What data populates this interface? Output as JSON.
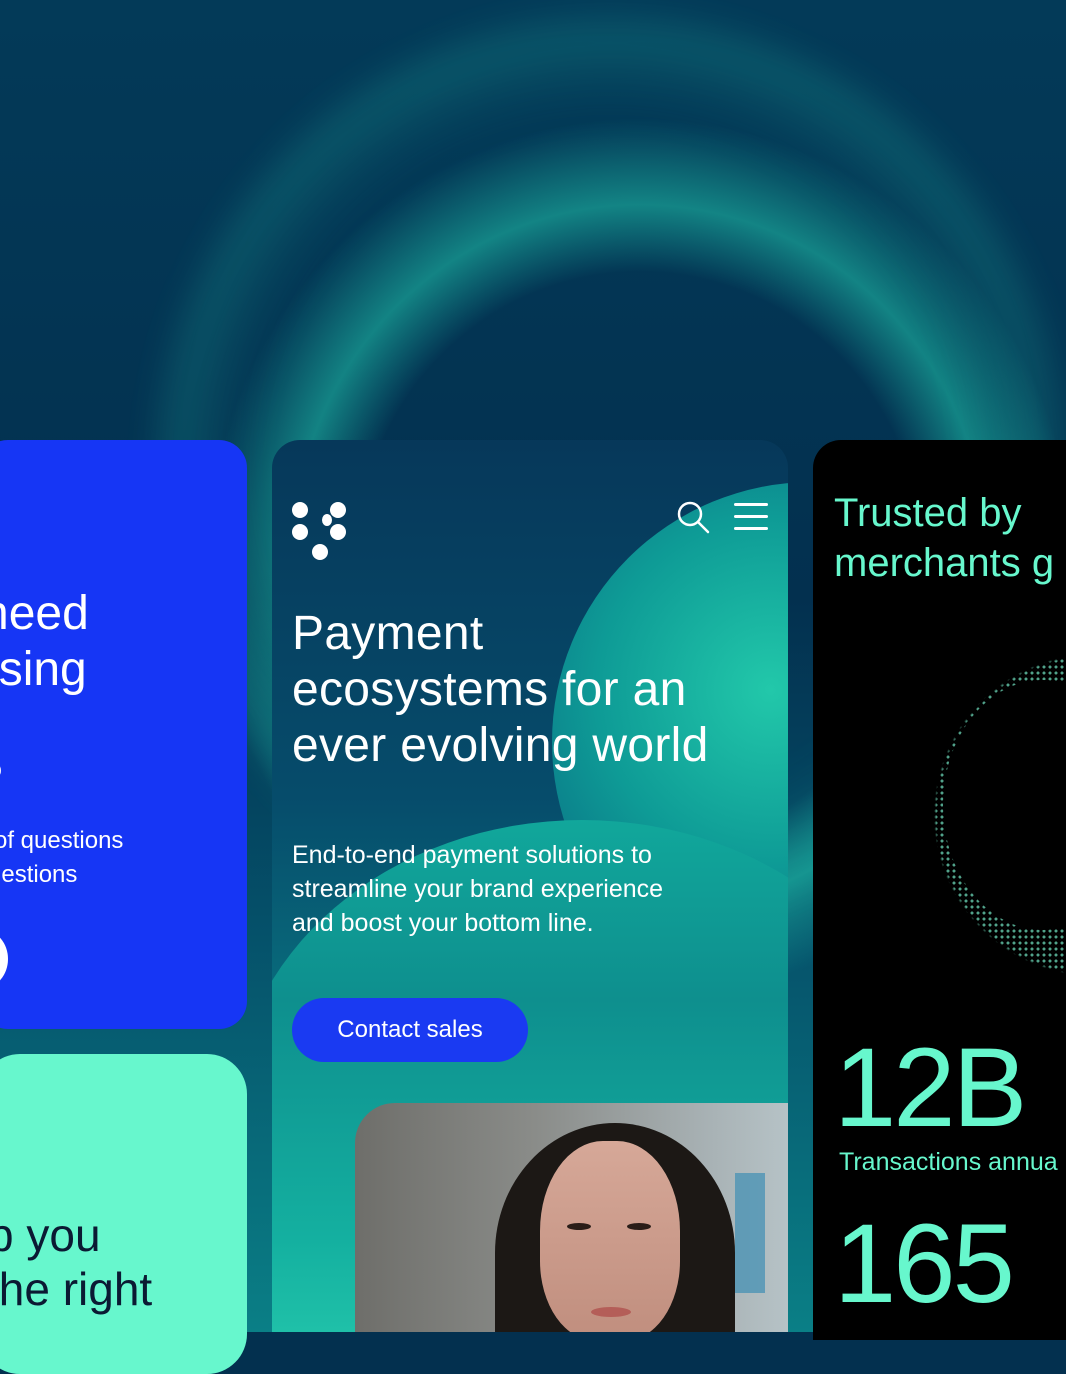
{
  "blue_card": {
    "lines": [
      "need",
      "osing",
      "?"
    ],
    "body_lines": [
      " of questions",
      "gestions"
    ]
  },
  "mint_card": {
    "lines": [
      "p you",
      "the right"
    ]
  },
  "phone": {
    "hero_title": "Payment ecosystems for an ever evolving world",
    "hero_subtitle": "End-to-end payment solutions to streamline your brand experience and boost your bottom line.",
    "cta_label": "Contact sales"
  },
  "stats_card": {
    "heading_line1": "Trusted by",
    "heading_line2": "merchants g",
    "stat1_value": "12B",
    "stat1_label": "Transactions annua",
    "stat2_value": "165"
  },
  "colors": {
    "brand_blue": "#1636f5",
    "mint": "#67f7cd",
    "deep_teal": "#03304f"
  }
}
